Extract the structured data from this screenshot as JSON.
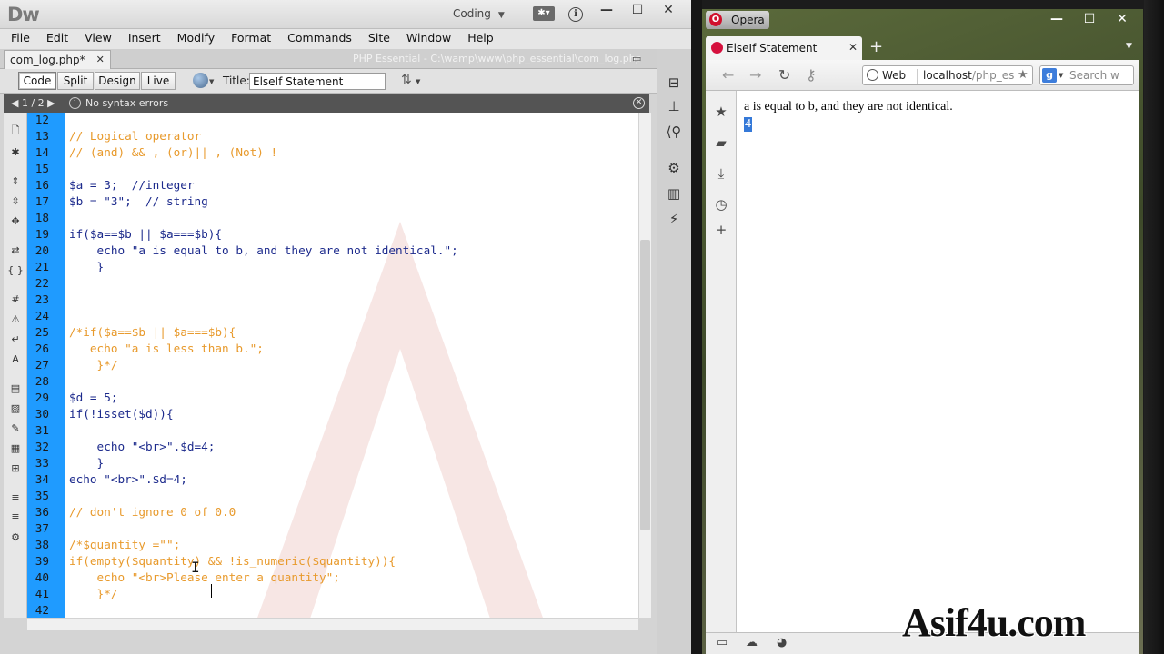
{
  "dreamweaver": {
    "logo": "Dw",
    "workspace": "Coding",
    "menu": [
      "File",
      "Edit",
      "View",
      "Insert",
      "Modify",
      "Format",
      "Commands",
      "Site",
      "Window",
      "Help"
    ],
    "doc_tab": "com_log.php*",
    "doc_path": "PHP Essential - C:\\wamp\\www\\php_essential\\com_log.php",
    "view_buttons": [
      "Code",
      "Split",
      "Design",
      "Live"
    ],
    "active_view": "Code",
    "title_label": "Title:",
    "title_value": "ElseIf Statement",
    "error_nav": "1 / 2",
    "error_text": "No syntax errors",
    "code_lines": [
      {
        "n": "12",
        "t": "",
        "k": "php"
      },
      {
        "n": "13",
        "t": "// Logical operator",
        "k": "comment"
      },
      {
        "n": "14",
        "t": "// (and) && , (or)|| , (Not) !",
        "k": "comment"
      },
      {
        "n": "15",
        "t": "",
        "k": "php"
      },
      {
        "n": "16",
        "t": "$a = 3;  //integer",
        "k": "php"
      },
      {
        "n": "17",
        "t": "$b = \"3\";  // string",
        "k": "php"
      },
      {
        "n": "18",
        "t": "",
        "k": "php"
      },
      {
        "n": "19",
        "t": "if($a==$b || $a===$b){",
        "k": "php"
      },
      {
        "n": "20",
        "t": "    echo \"a is equal to b, and they are not identical.\";",
        "k": "php"
      },
      {
        "n": "21",
        "t": "    }",
        "k": "php"
      },
      {
        "n": "22",
        "t": "",
        "k": "php"
      },
      {
        "n": "23",
        "t": "",
        "k": "php"
      },
      {
        "n": "24",
        "t": "",
        "k": "php"
      },
      {
        "n": "25",
        "t": "/*if($a==$b || $a===$b){",
        "k": "comment"
      },
      {
        "n": "26",
        "t": "   echo \"a is less than b.\";",
        "k": "comment"
      },
      {
        "n": "27",
        "t": "    }*/",
        "k": "comment"
      },
      {
        "n": "28",
        "t": "",
        "k": "php"
      },
      {
        "n": "29",
        "t": "$d = 5;",
        "k": "php"
      },
      {
        "n": "30",
        "t": "if(!isset($d)){",
        "k": "php"
      },
      {
        "n": "31",
        "t": "",
        "k": "php"
      },
      {
        "n": "32",
        "t": "    echo \"<br>\".$d=4;",
        "k": "php"
      },
      {
        "n": "33",
        "t": "    }",
        "k": "php"
      },
      {
        "n": "34",
        "t": "echo \"<br>\".$d=4;",
        "k": "php"
      },
      {
        "n": "35",
        "t": "",
        "k": "php"
      },
      {
        "n": "36",
        "t": "// don't ignore 0 of 0.0",
        "k": "comment"
      },
      {
        "n": "37",
        "t": "",
        "k": "php"
      },
      {
        "n": "38",
        "t": "/*$quantity =\"\";",
        "k": "comment"
      },
      {
        "n": "39",
        "t": "if(empty($quantity) && !is_numeric($quantity)){",
        "k": "comment"
      },
      {
        "n": "40",
        "t": "    echo \"<br>Please enter a quantity\";",
        "k": "comment"
      },
      {
        "n": "41",
        "t": "    }*/",
        "k": "comment"
      },
      {
        "n": "42",
        "t": "",
        "k": "php"
      }
    ],
    "colors": {
      "gutter": "#1f9bff",
      "comment": "#e89a2c",
      "code": "#1c2a8c"
    }
  },
  "opera": {
    "menu_label": "Opera",
    "tab_title": "ElseIf Statement",
    "address_mode": "Web",
    "url_host": "localhost",
    "url_rest": "/php_es",
    "search_placeholder": "Search w",
    "page_line1": "a is equal to b, and they are not identical.",
    "page_line2": "4",
    "accent": "#d0102c"
  },
  "watermark": {
    "brand": "Asif4u.com"
  }
}
